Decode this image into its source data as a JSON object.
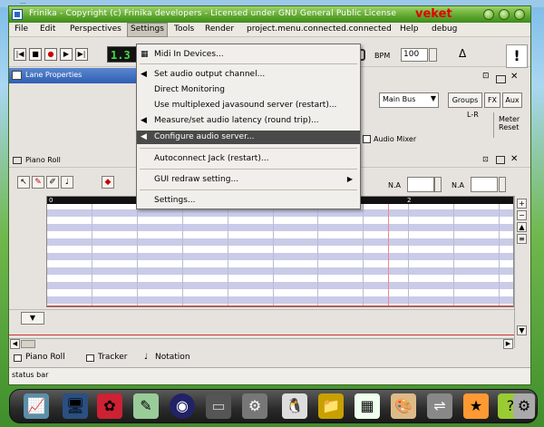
{
  "desktop": {
    "label": "..."
  },
  "window": {
    "title": "Frinika - Copyright (c) Frinika developers - Licensed under GNU General Public License",
    "brand": "veket"
  },
  "menubar": {
    "items": [
      "File",
      "Edit",
      "Perspectives",
      "Settings",
      "Tools",
      "Render",
      "project.menu.connected.connected",
      "Help",
      "debug"
    ],
    "active": "Settings"
  },
  "transport": {
    "time_display": "1.3",
    "bpm_label": "BPM",
    "bpm_value": "100"
  },
  "lane_properties": {
    "title": "Lane Properties"
  },
  "mixer": {
    "bus_select": "Main Bus",
    "groups_label": "Groups",
    "fx_label": "FX",
    "aux_label": "Aux",
    "lr_label": "L-R",
    "meter_label": "Meter",
    "meter_reset": "Reset",
    "audio_mixer_tab": "Audio Mixer"
  },
  "piano_roll": {
    "title": "Piano Roll",
    "na_label_1": "N.A",
    "na_label_2": "N.A",
    "ruler_start": "0",
    "ruler_mark": "2"
  },
  "settings_menu": {
    "items": [
      {
        "label": "Midi In Devices..."
      },
      {
        "label": "Set audio output channel..."
      },
      {
        "label": "Direct Monitoring"
      },
      {
        "label": "Use multiplexed javasound server (restart)..."
      },
      {
        "label": "Measure/set audio latency (round trip)..."
      },
      {
        "label": "Configure audio server..."
      },
      {
        "label": "Autoconnect Jack (restart)..."
      },
      {
        "label": "GUI redraw setting..."
      },
      {
        "label": "Settings..."
      }
    ],
    "highlighted": "Configure audio server..."
  },
  "bottom_tabs": [
    "Piano Roll",
    "Tracker",
    "Notation"
  ],
  "statusbar": {
    "text": "status bar"
  },
  "dock": {
    "icons": [
      "monitor-icon",
      "computer-icon",
      "bug-icon",
      "edit-icon",
      "media-icon",
      "screen-icon",
      "gear-icon",
      "penguin-icon",
      "folder-icon",
      "paint-icon",
      "palette-icon",
      "usb-icon",
      "sticker-icon",
      "help-icon",
      "settings-icon"
    ]
  }
}
